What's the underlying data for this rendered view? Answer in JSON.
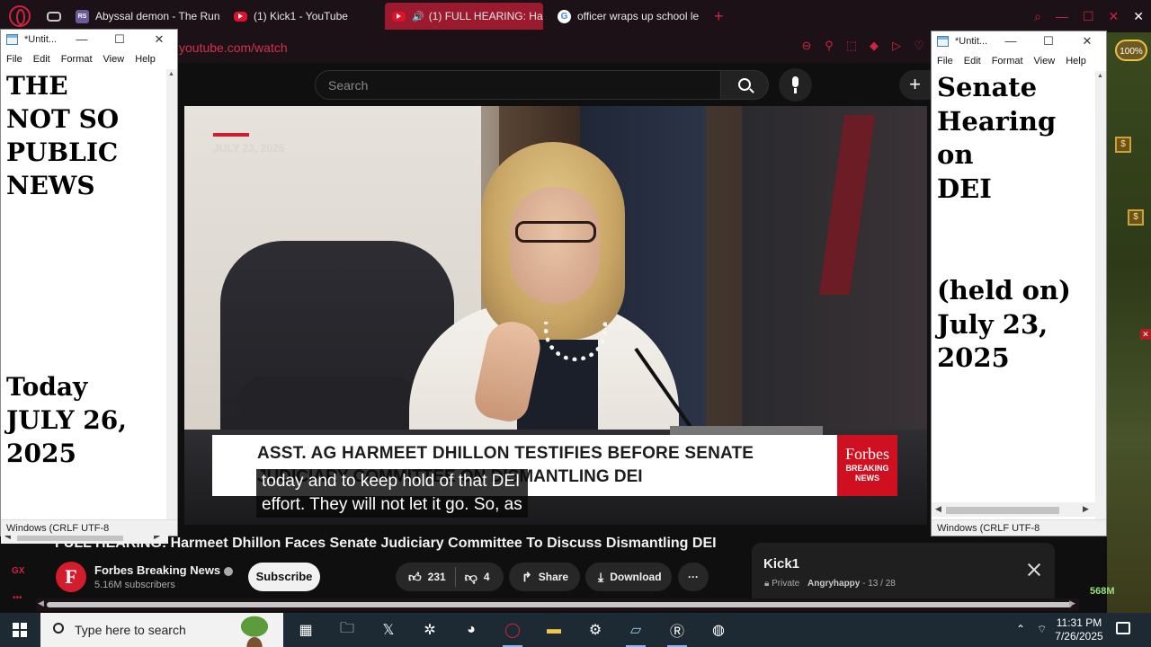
{
  "browser": {
    "tabs": [
      {
        "label": "Abyssal demon - The Run",
        "favicon": "RS"
      },
      {
        "label": "(1) Kick1 - YouTube",
        "favicon": "youtube"
      },
      {
        "label": "(1) FULL HEARING: Ha",
        "favicon": "youtube",
        "active": true
      },
      {
        "label": "officer wraps up school le",
        "favicon": "G"
      }
    ],
    "url": "youtube.com/watch",
    "accent_color": "#d02341"
  },
  "youtube": {
    "search_placeholder": "Search",
    "video": {
      "date_overlay": "JULY 23, 2025",
      "lower_third_line1": "ASST. AG HARMEET DHILLON TESTIFIES BEFORE SENATE",
      "lower_third_line2": "JUDICIARY COMMITTEE ON DISMANTLING DEI",
      "brand_name": "Forbes",
      "brand_sub1": "BREAKING",
      "brand_sub2": "NEWS",
      "caption_line1": "today and to keep hold of that DEI",
      "caption_line2": "effort. They will not let it go. So, as"
    },
    "title": "FULL HEARING: Harmeet Dhillon Faces Senate Judiciary Committee To Discuss Dismantling DEI",
    "channel": {
      "avatar_letter": "F",
      "name": "Forbes Breaking News",
      "subscribers": "5.16M subscribers"
    },
    "subscribe_label": "Subscribe",
    "likes": "231",
    "dislikes": "4",
    "share_label": "Share",
    "download_label": "Download",
    "more_label": "···",
    "playlist": {
      "title": "Kick1",
      "privacy": "Private",
      "owner": "Angryhappy",
      "position": "13 / 28"
    }
  },
  "opera_sidebar": {
    "gx_label": "GX",
    "dots": "•••"
  },
  "game_overlay": {
    "percent": "100%",
    "memory": "568M",
    "coin_icon": "$"
  },
  "notepad_left": {
    "title": "*Untit...",
    "menu": [
      "File",
      "Edit",
      "Format",
      "View",
      "Help"
    ],
    "lines": [
      "THE",
      "NOT SO",
      "PUBLIC",
      "NEWS",
      "",
      "",
      "",
      "",
      "",
      "Today",
      "JULY 26,",
      "2025"
    ],
    "status": "Windows (CRLF  UTF-8"
  },
  "notepad_right": {
    "title": "*Untit...",
    "menu": [
      "File",
      "Edit",
      "Format",
      "View",
      "Help"
    ],
    "lines": [
      "Senate",
      "Hearing",
      "on",
      "DEI",
      "",
      "",
      "",
      "(held on)",
      "July 23,",
      "2025"
    ],
    "status": "Windows (CRLF  UTF-8"
  },
  "taskbar": {
    "search_placeholder": "Type here to search",
    "time": "11:31 PM",
    "date": "7/26/2025"
  }
}
